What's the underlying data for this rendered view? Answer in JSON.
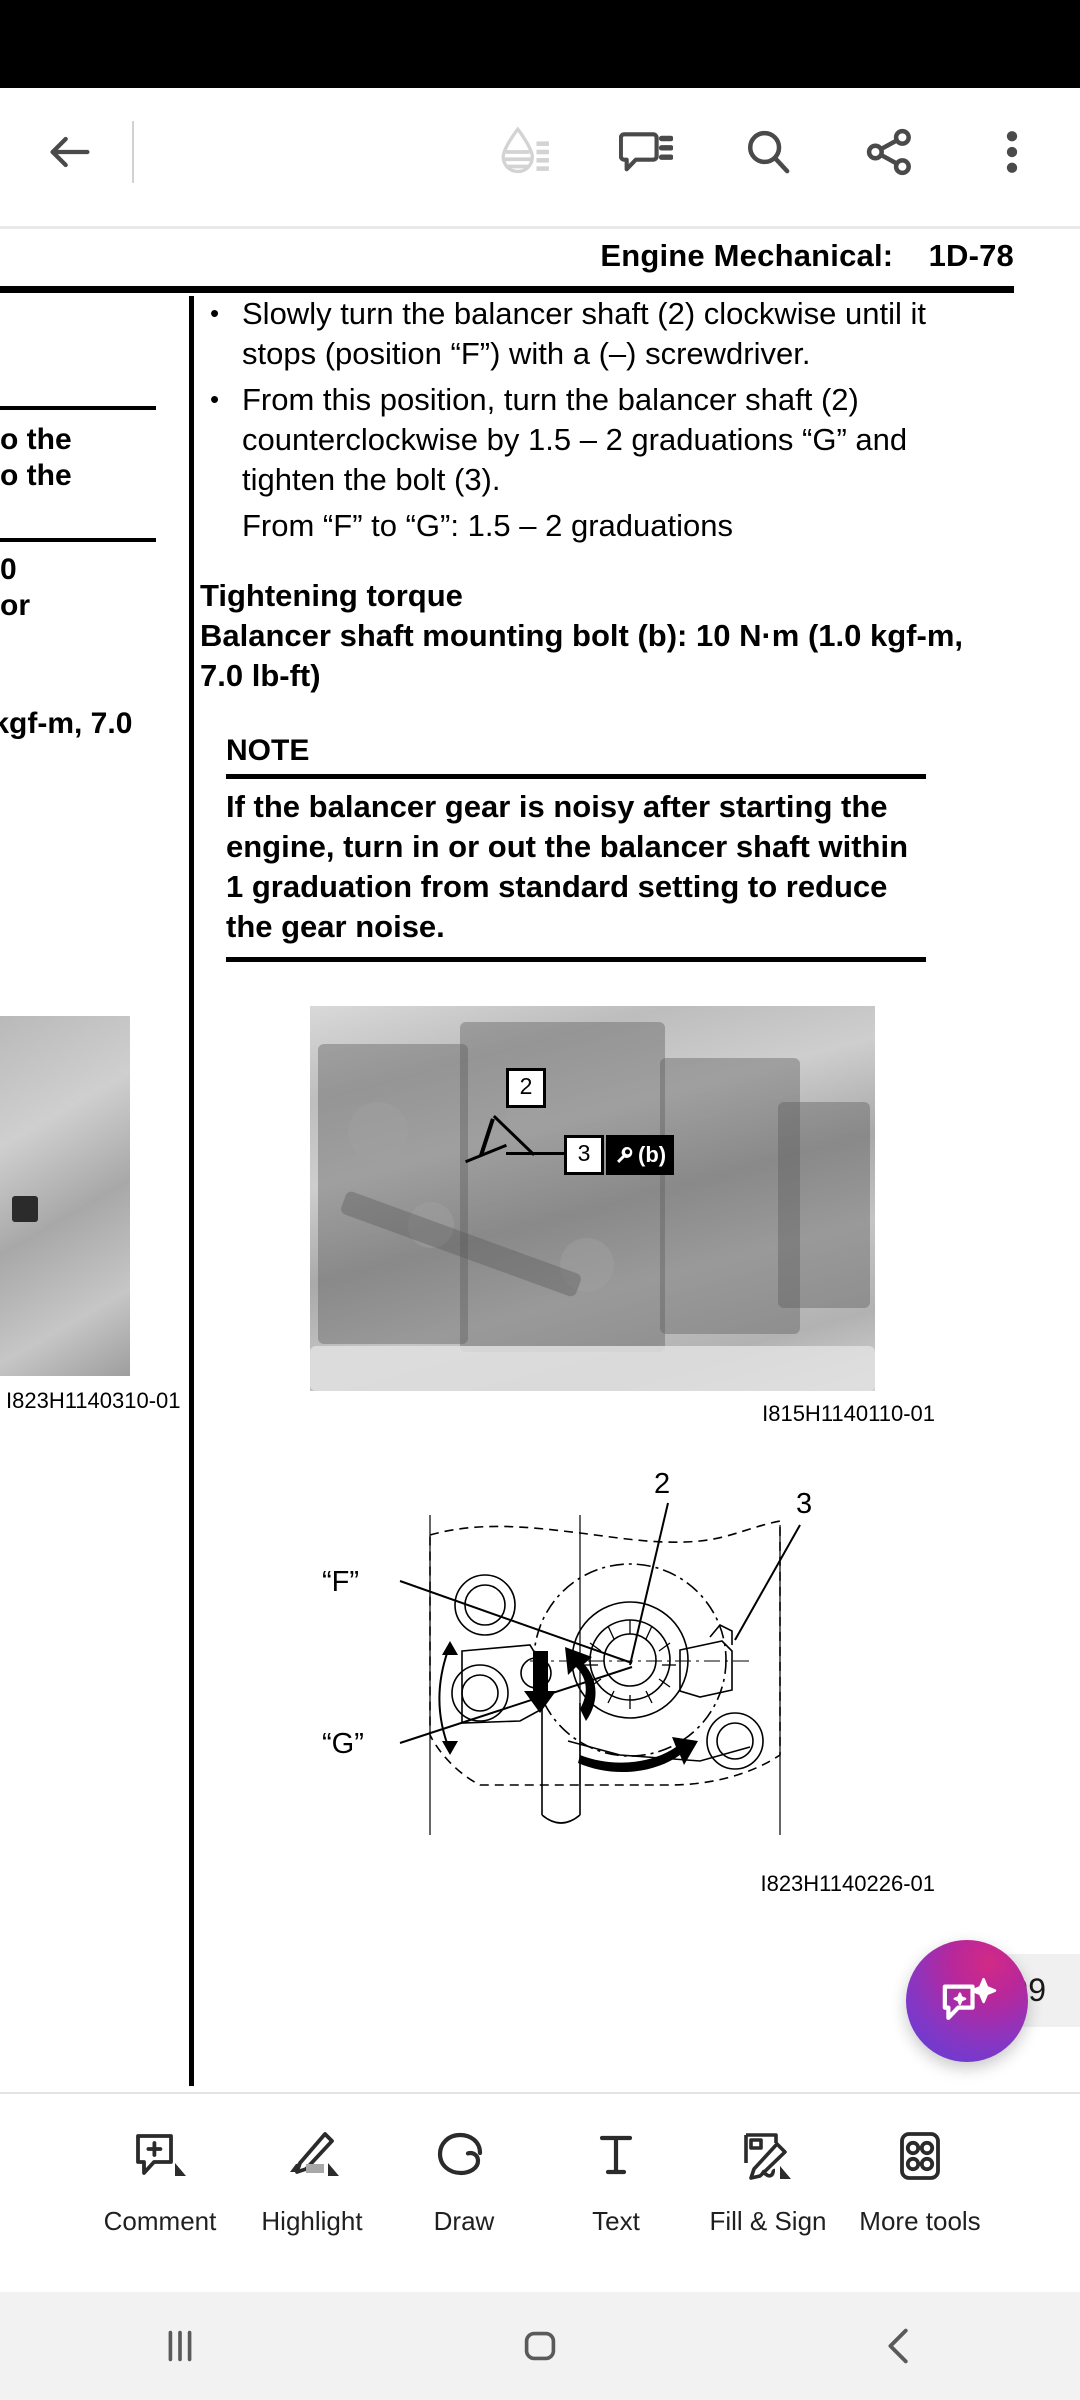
{
  "app": {
    "statusbar": {
      "style": "black-notch"
    },
    "topbar": {
      "back_icon": "back-arrow-icon",
      "icons": [
        {
          "name": "liquid-mode-icon",
          "label": "Liquid Mode",
          "state": "disabled"
        },
        {
          "name": "comment-list-icon",
          "label": "Comments"
        },
        {
          "name": "search-icon",
          "label": "Search"
        },
        {
          "name": "share-icon",
          "label": "Share"
        },
        {
          "name": "overflow-menu-icon",
          "label": "More options"
        }
      ]
    }
  },
  "document": {
    "running_head": "Engine Mechanical:    1D-78",
    "page_number": "299",
    "left_column": {
      "fragments": [
        "o the",
        "o the",
        "0",
        "or",
        " kgf-m, 7.0"
      ],
      "figure_caption": "I823H1140310-01"
    },
    "bullets": [
      "Slowly turn the balancer shaft (2) clockwise until it stops (position “F”) with a (–) screwdriver.",
      "From this position, turn the balancer shaft (2) counterclockwise by 1.5 – 2 graduations “G” and tighten the bolt (3)."
    ],
    "sub_line": "From “F” to “G”: 1.5 – 2 graduations",
    "torque": {
      "title": "Tightening torque",
      "value": "Balancer shaft mounting bolt (b):  10 N·m (1.0 kgf-m, 7.0 lb-ft)"
    },
    "note": {
      "label": "NOTE",
      "body": "If the balancer gear is noisy after starting the engine, turn in or out the balancer shaft within 1 graduation from standard setting to reduce the gear noise."
    },
    "figure_photo": {
      "caption": "I815H1140110-01",
      "callout_2": "2",
      "callout_3": "3",
      "callout_b": "(b)"
    },
    "figure_drawing": {
      "caption": "I823H1140226-01",
      "label_F": "“F”",
      "label_G": "“G”",
      "callout_2": "2",
      "callout_3": "3"
    }
  },
  "assistant_fab": {
    "name": "ai-assistant-fab",
    "icon": "chat-sparkle-icon"
  },
  "toolbar": {
    "tools": [
      {
        "label": "Comment",
        "icon": "comment-add-icon"
      },
      {
        "label": "Highlight",
        "icon": "highlighter-icon"
      },
      {
        "label": "Draw",
        "icon": "draw-scribble-icon"
      },
      {
        "label": "Text",
        "icon": "text-tool-icon"
      },
      {
        "label": "Fill & Sign",
        "icon": "fill-sign-icon"
      },
      {
        "label": "More tools",
        "icon": "more-tools-grid-icon"
      }
    ]
  },
  "navbar": {
    "recents_icon": "recents-icon",
    "home_icon": "home-icon",
    "back_icon": "nav-back-icon"
  },
  "colors": {
    "statusbar_bg": "#000000",
    "appbar_bg": "#ffffff",
    "icon": "#4a4a4a",
    "fab_gradient_start": "#d22a86",
    "fab_gradient_end": "#5b3fdc",
    "page_pill_bg": "#f0f0f0",
    "navbar_bg": "#f2f2f2"
  }
}
